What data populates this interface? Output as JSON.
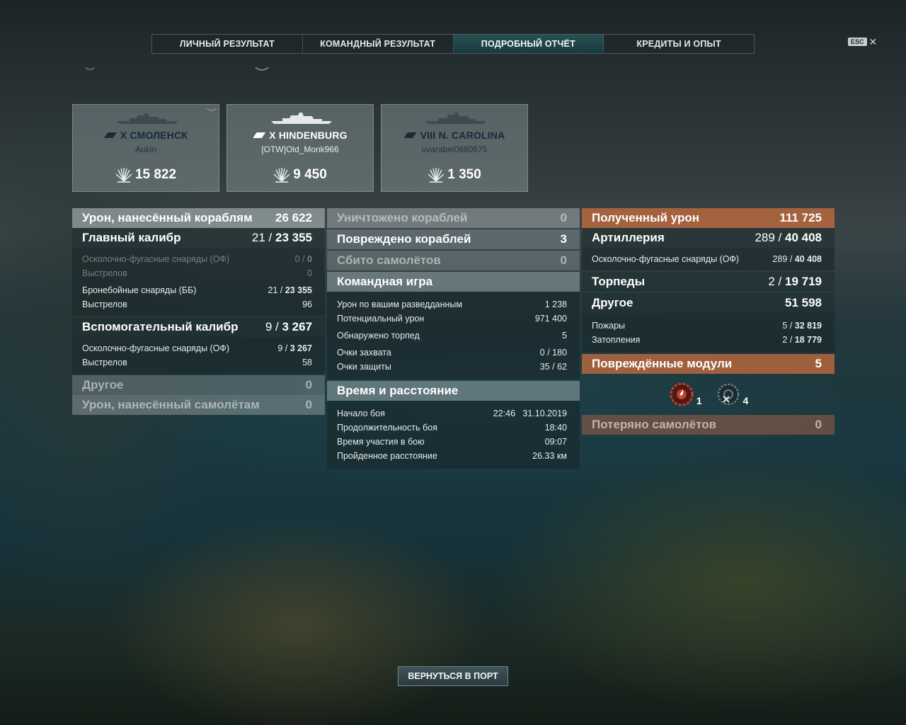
{
  "tabs": [
    {
      "label": "ЛИЧНЫЙ РЕЗУЛЬТАТ",
      "active": false
    },
    {
      "label": "КОМАНДНЫЙ РЕЗУЛЬТАТ",
      "active": false
    },
    {
      "label": "ПОДРОБНЫЙ ОТЧЁТ",
      "active": true
    },
    {
      "label": "КРЕДИТЫ И ОПЫТ",
      "active": false
    }
  ],
  "esc": {
    "key": "ESC",
    "icon": "close-icon"
  },
  "ships": [
    {
      "name": "X СМОЛЕНСК",
      "player": "Aukin",
      "damage": "15 822",
      "highlighted": false
    },
    {
      "name": "X HINDENBURG",
      "player": "[OTW]Old_Monk966",
      "damage": "9 450",
      "highlighted": true
    },
    {
      "name": "VIII N. CAROLINA",
      "player": "uvarabei0880675",
      "damage": "1 350",
      "highlighted": false
    }
  ],
  "left": {
    "ship_damage": {
      "label": "Урон, нанесённый кораблям",
      "value": "26 622"
    },
    "main_battery": {
      "label": "Главный калибр",
      "hits": "21",
      "damage": "23 355"
    },
    "he_main": {
      "label": "Осколочно-фугасные снаряды (ОФ)",
      "hits": "0",
      "damage": "0"
    },
    "he_main_shots": {
      "label": "Выстрелов",
      "value": "0"
    },
    "ap_main": {
      "label": "Бронебойные снаряды (ББ)",
      "hits": "21",
      "damage": "23 355"
    },
    "ap_main_shots": {
      "label": "Выстрелов",
      "value": "96"
    },
    "secondary": {
      "label": "Вспомогательный калибр",
      "hits": "9",
      "damage": "3 267"
    },
    "he_sec": {
      "label": "Осколочно-фугасные снаряды (ОФ)",
      "hits": "9",
      "damage": "3 267"
    },
    "he_sec_shots": {
      "label": "Выстрелов",
      "value": "58"
    },
    "other": {
      "label": "Другое",
      "value": "0"
    },
    "plane_damage": {
      "label": "Урон, нанесённый самолётам",
      "value": "0"
    }
  },
  "middle": {
    "destroyed": {
      "label": "Уничтожено кораблей",
      "value": "0"
    },
    "damaged": {
      "label": "Повреждено кораблей",
      "value": "3"
    },
    "planes_shot": {
      "label": "Сбито самолётов",
      "value": "0"
    },
    "team_play": {
      "title": "Командная игра",
      "spotting_damage": {
        "label": "Урон по вашим разведданным",
        "value": "1 238"
      },
      "potential_damage": {
        "label": "Потенциальный урон",
        "value": "971 400"
      },
      "torps_spotted": {
        "label": "Обнаружено торпед",
        "value": "5"
      },
      "capture": {
        "label": "Очки захвата",
        "value": "0 / 180"
      },
      "defense": {
        "label": "Очки защиты",
        "value": "35 / 62"
      }
    },
    "time_distance": {
      "title": "Время и расстояние",
      "start": {
        "label": "Начало боя",
        "value": "22:46   31.10.2019"
      },
      "duration": {
        "label": "Продолжительность боя",
        "value": "18:40"
      },
      "participation": {
        "label": "Время участия в бою",
        "value": "09:07"
      },
      "distance": {
        "label": "Пройденное расстояние",
        "value": "26.33 км"
      }
    }
  },
  "right": {
    "received": {
      "label": "Полученный урон",
      "value": "111 725"
    },
    "artillery": {
      "label": "Артиллерия",
      "hits": "289",
      "damage": "40 408"
    },
    "he_art": {
      "label": "Осколочно-фугасные снаряды (ОФ)",
      "hits": "289",
      "damage": "40 408"
    },
    "torpedoes": {
      "label": "Торпеды",
      "hits": "2",
      "damage": "19 719"
    },
    "other": {
      "label": "Другое",
      "value": "51 598"
    },
    "fires": {
      "label": "Пожары",
      "hits": "5",
      "damage": "32 819"
    },
    "floods": {
      "label": "Затопления",
      "hits": "2",
      "damage": "18 779"
    },
    "modules": {
      "label": "Повреждённые модули",
      "value": "5"
    },
    "module_icons": [
      {
        "icon": "engine-damaged-icon",
        "count": "1"
      },
      {
        "icon": "steering-destroyed-icon",
        "count": "4"
      }
    ],
    "planes_lost": {
      "label": "Потеряно самолётов",
      "value": "0"
    }
  },
  "back_button": "ВЕРНУТЬСЯ В ПОРТ"
}
